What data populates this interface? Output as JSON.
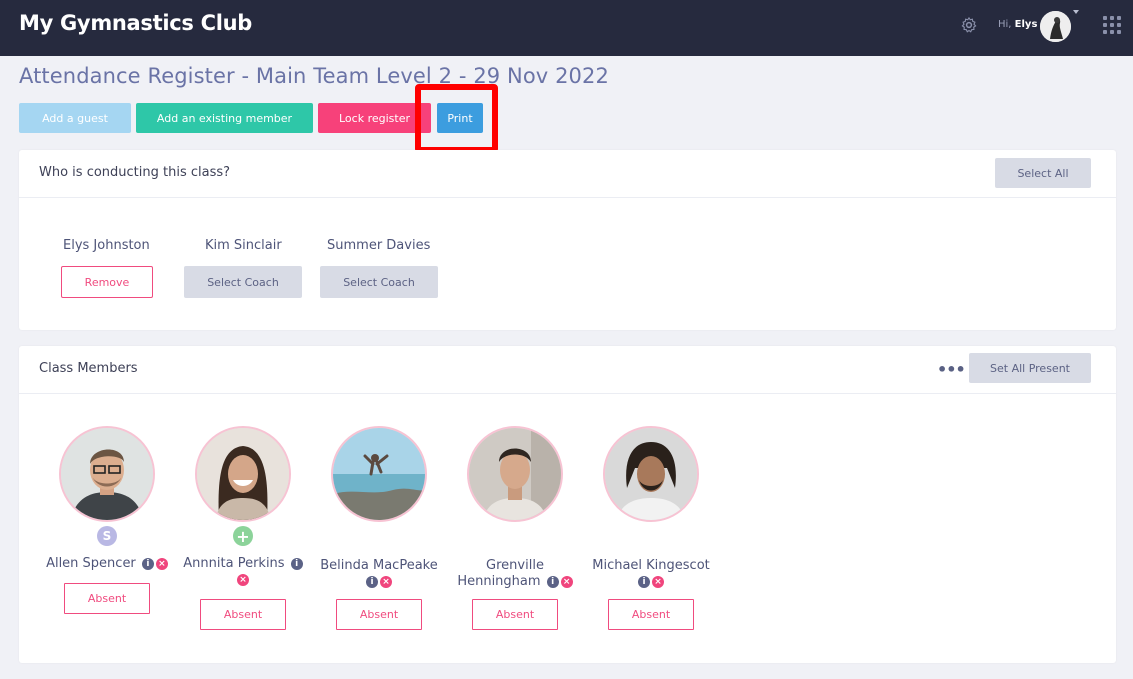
{
  "app": {
    "title": "My Gymnastics Club"
  },
  "header": {
    "greeting": "Hi,",
    "user_name": "Elys"
  },
  "page": {
    "title": "Attendance Register - Main Team Level 2 - 29 Nov 2022"
  },
  "actions": {
    "add_guest": "Add a guest",
    "add_existing": "Add an existing member",
    "lock": "Lock register",
    "print": "Print"
  },
  "coaches_card": {
    "title": "Who is conducting this class?",
    "select_all": "Select All",
    "coaches": [
      {
        "name": "Elys Johnston",
        "action": "Remove"
      },
      {
        "name": "Kim Sinclair",
        "action": "Select Coach"
      },
      {
        "name": "Summer Davies",
        "action": "Select Coach"
      }
    ]
  },
  "members_card": {
    "title": "Class Members",
    "more": "•••",
    "set_all_present": "Set All Present",
    "members": [
      {
        "name": "Allen Spencer",
        "badge": "S",
        "status": "Absent"
      },
      {
        "name": "Annnita Perkins",
        "badge": "+",
        "status": "Absent"
      },
      {
        "name": "Belinda MacPeake",
        "status": "Absent"
      },
      {
        "name_line1": "Grenville",
        "name_line2": "Henningham",
        "status": "Absent"
      },
      {
        "name": "Michael Kingescot",
        "status": "Absent"
      }
    ]
  },
  "colors": {
    "topbar": "#262a3e",
    "accent_pink": "#f04b7f",
    "accent_teal": "#2ec7a8",
    "accent_blue": "#3c9ddf",
    "highlight": "#ff0000"
  },
  "icons": {
    "settings": "gear-icon",
    "apps": "grid-icon",
    "info": "info-icon",
    "remove": "close-icon"
  }
}
